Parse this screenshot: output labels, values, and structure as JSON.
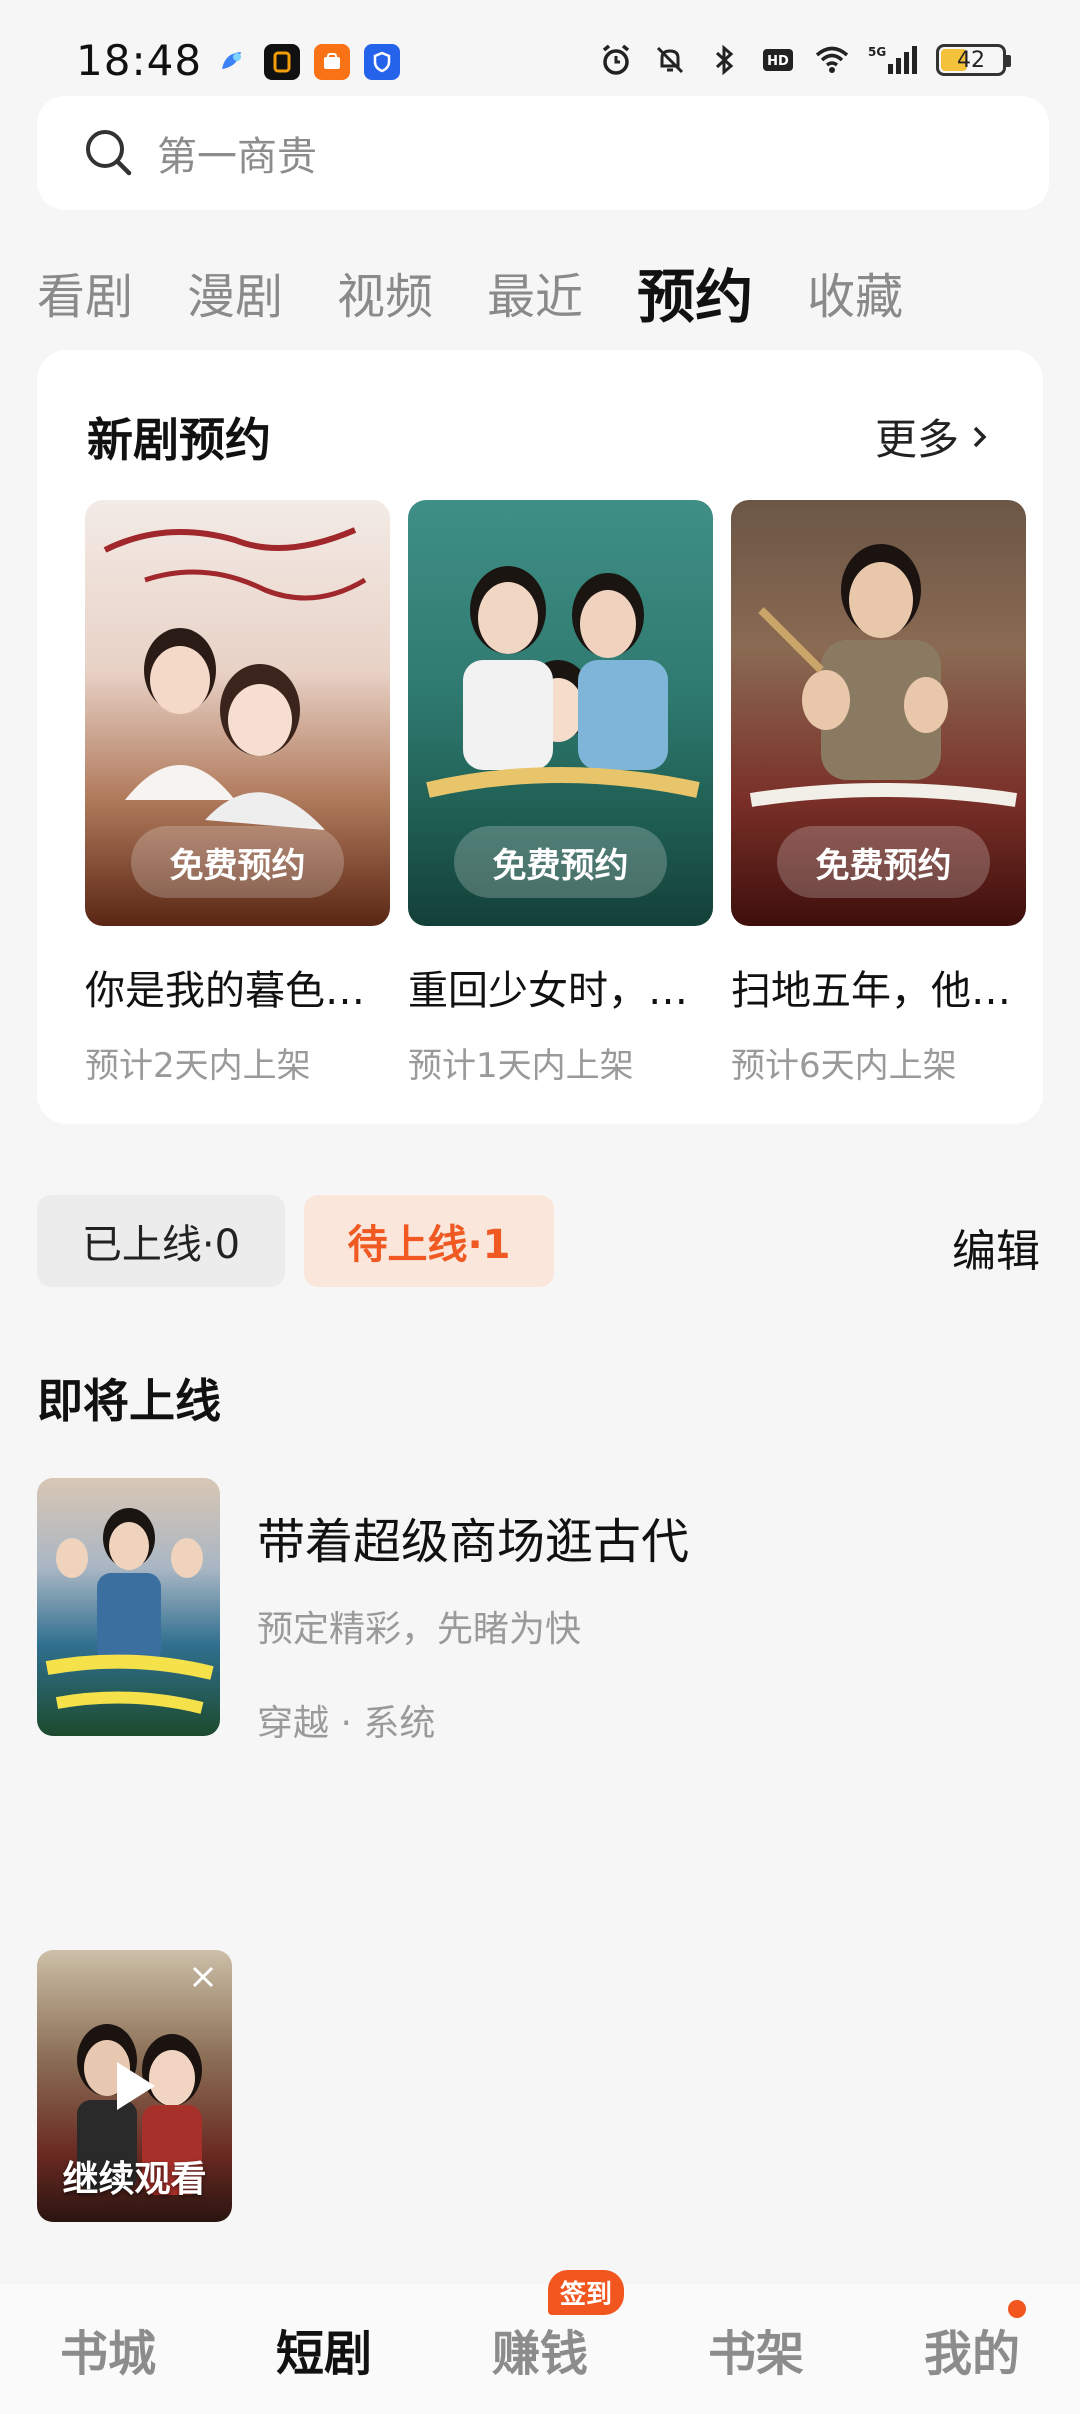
{
  "status": {
    "time": "18:48",
    "battery": "42"
  },
  "search": {
    "placeholder": "第一商贵"
  },
  "tabs": [
    {
      "label": "看剧"
    },
    {
      "label": "漫剧"
    },
    {
      "label": "视频"
    },
    {
      "label": "最近"
    },
    {
      "label": "预约",
      "active": true
    },
    {
      "label": "收藏"
    }
  ],
  "new_drama": {
    "title": "新剧预约",
    "more": "更多",
    "items": [
      {
        "name": "你是我的暮色黯然",
        "sub": "预计2天内上架",
        "button": "免费预约"
      },
      {
        "name": "重回少女时，被弃之子",
        "sub": "预计1天内上架",
        "button": "免费预约"
      },
      {
        "name": "扫地五年，他竟是",
        "sub": "预计6天内上架",
        "button": "免费预约"
      }
    ]
  },
  "filters": {
    "online": "已上线·0",
    "pending": "待上线·1",
    "edit": "编辑"
  },
  "upcoming": {
    "section_title": "即将上线",
    "item": {
      "title": "带着超级商场逛古代",
      "desc": "预定精彩，先睹为快",
      "tags": "穿越 · 系统"
    }
  },
  "float": {
    "label": "继续观看"
  },
  "bottom_nav": {
    "items": [
      {
        "label": "书城"
      },
      {
        "label": "短剧",
        "active": true
      },
      {
        "label": "赚钱",
        "badge": "签到"
      },
      {
        "label": "书架"
      },
      {
        "label": "我的"
      }
    ]
  }
}
